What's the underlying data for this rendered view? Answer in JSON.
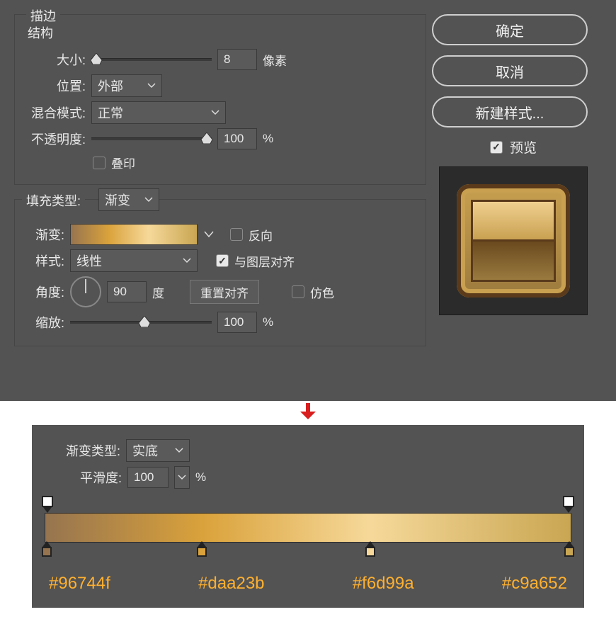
{
  "panel": {
    "title": "描边",
    "structure_title": "结构",
    "size_label": "大小:",
    "size_value": "8",
    "size_unit": "像素",
    "position_label": "位置:",
    "position_value": "外部",
    "blend_label": "混合模式:",
    "blend_value": "正常",
    "opacity_label": "不透明度:",
    "opacity_value": "100",
    "opacity_unit": "%",
    "overprint_label": "叠印"
  },
  "fill": {
    "fill_type_label": "填充类型:",
    "fill_type_value": "渐变",
    "gradient_label": "渐变:",
    "reverse_label": "反向",
    "style_label": "样式:",
    "style_value": "线性",
    "align_label": "与图层对齐",
    "angle_label": "角度:",
    "angle_value": "90",
    "angle_unit": "度",
    "reset_align": "重置对齐",
    "dither_label": "仿色",
    "scale_label": "缩放:",
    "scale_value": "100",
    "scale_unit": "%"
  },
  "side": {
    "ok": "确定",
    "cancel": "取消",
    "new_style": "新建样式...",
    "preview": "预览"
  },
  "gradient_editor": {
    "type_label": "渐变类型:",
    "type_value": "实底",
    "smooth_label": "平滑度:",
    "smooth_value": "100",
    "smooth_unit": "%",
    "stops": [
      {
        "hex": "#96744f",
        "pos": 0
      },
      {
        "hex": "#daa23b",
        "pos": 30
      },
      {
        "hex": "#f6d99a",
        "pos": 62
      },
      {
        "hex": "#c9a652",
        "pos": 100
      }
    ]
  }
}
